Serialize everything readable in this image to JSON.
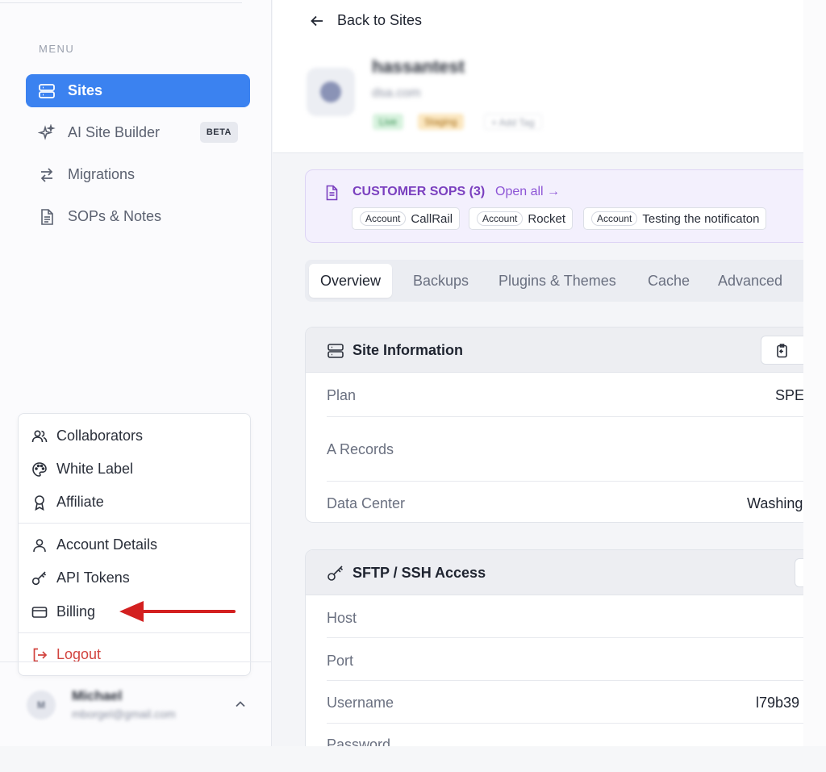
{
  "sidebar": {
    "menu_label": "MENU",
    "items": [
      {
        "label": "Sites",
        "icon": "server-icon"
      },
      {
        "label": "AI Site Builder",
        "icon": "sparkles-icon",
        "badge": "BETA"
      },
      {
        "label": "Migrations",
        "icon": "arrows-swap-icon"
      },
      {
        "label": "SOPs & Notes",
        "icon": "document-icon"
      }
    ],
    "dropdown": [
      {
        "label": "Collaborators",
        "icon": "users-icon"
      },
      {
        "label": "White Label",
        "icon": "palette-icon"
      },
      {
        "label": "Affiliate",
        "icon": "award-icon"
      },
      {
        "label": "Account Details",
        "icon": "user-icon"
      },
      {
        "label": "API Tokens",
        "icon": "key-icon"
      },
      {
        "label": "Billing",
        "icon": "credit-card-icon"
      },
      {
        "label": "Logout",
        "icon": "logout-icon"
      }
    ],
    "user": {
      "initial": "M",
      "name": "Michael",
      "email": "mborgel@gmail.com"
    }
  },
  "header": {
    "back_label": "Back to Sites",
    "site_name": "hassantest",
    "site_domain": "dsa.com",
    "tags": [
      "Live",
      "Staging",
      "+ Add Tag"
    ]
  },
  "sops": {
    "title": "CUSTOMER SOPS (3)",
    "open_all": "Open all →",
    "chip_badge": "Account",
    "chips": [
      "CallRail",
      "Rocket",
      "Testing the notificaton"
    ]
  },
  "tabs": [
    "Overview",
    "Backups",
    "Plugins & Themes",
    "Cache",
    "Advanced"
  ],
  "site_info": {
    "title": "Site Information",
    "rows": [
      {
        "label": "Plan",
        "value": "SPEI"
      },
      {
        "label": "A Records",
        "value": ""
      },
      {
        "label": "Data Center",
        "value": "Washing"
      }
    ]
  },
  "sftp": {
    "title": "SFTP / SSH Access",
    "rows": [
      {
        "label": "Host",
        "value": ""
      },
      {
        "label": "Port",
        "value": ""
      },
      {
        "label": "Username",
        "value": "l79b39"
      },
      {
        "label": "Password",
        "value": ""
      }
    ]
  },
  "colors": {
    "accent": "#3b82f0",
    "logout": "#d2443f",
    "sops_purple": "#7a3fbf",
    "arrow": "#d32020"
  }
}
